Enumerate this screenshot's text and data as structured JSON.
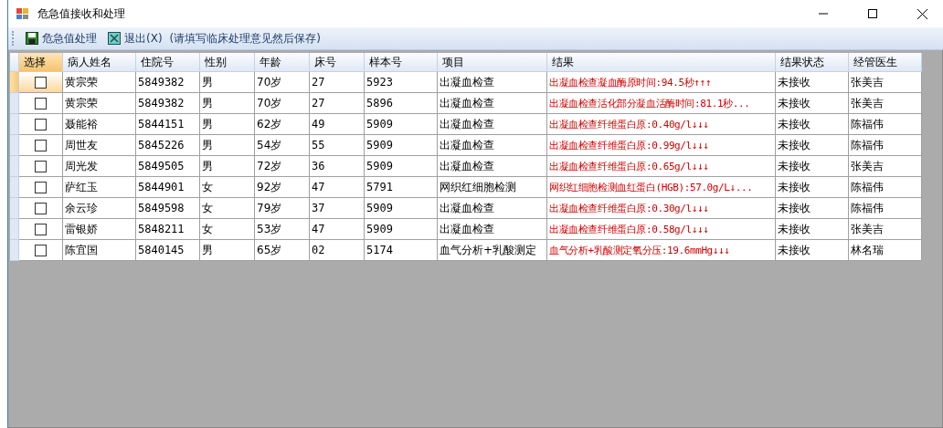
{
  "window": {
    "title": "危急值接收和处理"
  },
  "toolbar": {
    "buttons": [
      {
        "kind": "save",
        "label": "危急值处理"
      },
      {
        "kind": "exit",
        "label": "退出(X)"
      }
    ],
    "hint": "(请填写临床处理意见然后保存)"
  },
  "table": {
    "checkbox_column": "选择",
    "columns": [
      "病人姓名",
      "住院号",
      "性别",
      "年龄",
      "床号",
      "样本号",
      "项目",
      "结果",
      "结果状态",
      "经管医生"
    ],
    "rows": [
      {
        "current": true,
        "checked": false,
        "cells": [
          "黄宗荣",
          "5849382",
          "男",
          "70岁",
          "27",
          "5923",
          "出凝血检查",
          "出凝血检查凝血酶原时间:94.5秒↑↑↑",
          "未接收",
          "张美吉"
        ]
      },
      {
        "current": false,
        "checked": false,
        "cells": [
          "黄宗荣",
          "5849382",
          "男",
          "70岁",
          "27",
          "5896",
          "出凝血检查",
          "出凝血检查活化部分凝血活酶时间:81.1秒...",
          "未接收",
          "张美吉"
        ]
      },
      {
        "current": false,
        "checked": false,
        "cells": [
          "聂能裕",
          "5844151",
          "男",
          "62岁",
          "49",
          "5909",
          "出凝血检查",
          "出凝血检查纤维蛋白原:0.40g/l↓↓↓",
          "未接收",
          "陈福伟"
        ]
      },
      {
        "current": false,
        "checked": false,
        "cells": [
          "周世友",
          "5845226",
          "男",
          "54岁",
          "55",
          "5909",
          "出凝血检查",
          "出凝血检查纤维蛋白原:0.99g/l↓↓↓",
          "未接收",
          "陈福伟"
        ]
      },
      {
        "current": false,
        "checked": false,
        "cells": [
          "周光发",
          "5849505",
          "男",
          "72岁",
          "36",
          "5909",
          "出凝血检查",
          "出凝血检查纤维蛋白原:0.65g/l↓↓↓",
          "未接收",
          "张美吉"
        ]
      },
      {
        "current": false,
        "checked": false,
        "cells": [
          "萨红玉",
          "5844901",
          "女",
          "92岁",
          "47",
          "5791",
          "网织红细胞检测",
          "网织红细胞检测血红蛋白(HGB):57.0g/L↓...",
          "未接收",
          "陈福伟"
        ]
      },
      {
        "current": false,
        "checked": false,
        "cells": [
          "余云珍",
          "5849598",
          "女",
          "79岁",
          "37",
          "5909",
          "出凝血检查",
          "出凝血检查纤维蛋白原:0.30g/l↓↓↓",
          "未接收",
          "陈福伟"
        ]
      },
      {
        "current": false,
        "checked": false,
        "cells": [
          "雷银娇",
          "5848211",
          "女",
          "53岁",
          "47",
          "5909",
          "出凝血检查",
          "出凝血检查纤维蛋白原:0.58g/l↓↓↓",
          "未接收",
          "张美吉"
        ]
      },
      {
        "current": false,
        "checked": false,
        "cells": [
          "陈宜国",
          "5840145",
          "男",
          "65岁",
          "02",
          "5174",
          "血气分析+乳酸测定",
          "血气分析+乳酸测定氧分压:19.6mmHg↓↓↓",
          "未接收",
          "林名瑞"
        ]
      }
    ]
  }
}
